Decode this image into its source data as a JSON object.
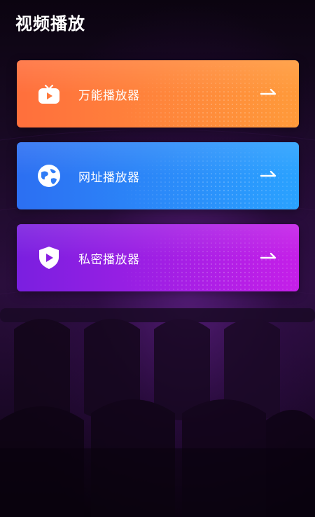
{
  "header": {
    "title": "视频播放"
  },
  "cards": [
    {
      "label": "万能播放器",
      "icon": "tv-icon",
      "gradient_start": "#ff7a3d",
      "gradient_end": "#ff9a3a"
    },
    {
      "label": "网址播放器",
      "icon": "globe-icon",
      "gradient_start": "#2f7cf6",
      "gradient_end": "#2aa0ff"
    },
    {
      "label": "私密播放器",
      "icon": "shield-play-icon",
      "gradient_start": "#7b1fe0",
      "gradient_end": "#c21ee6"
    }
  ]
}
